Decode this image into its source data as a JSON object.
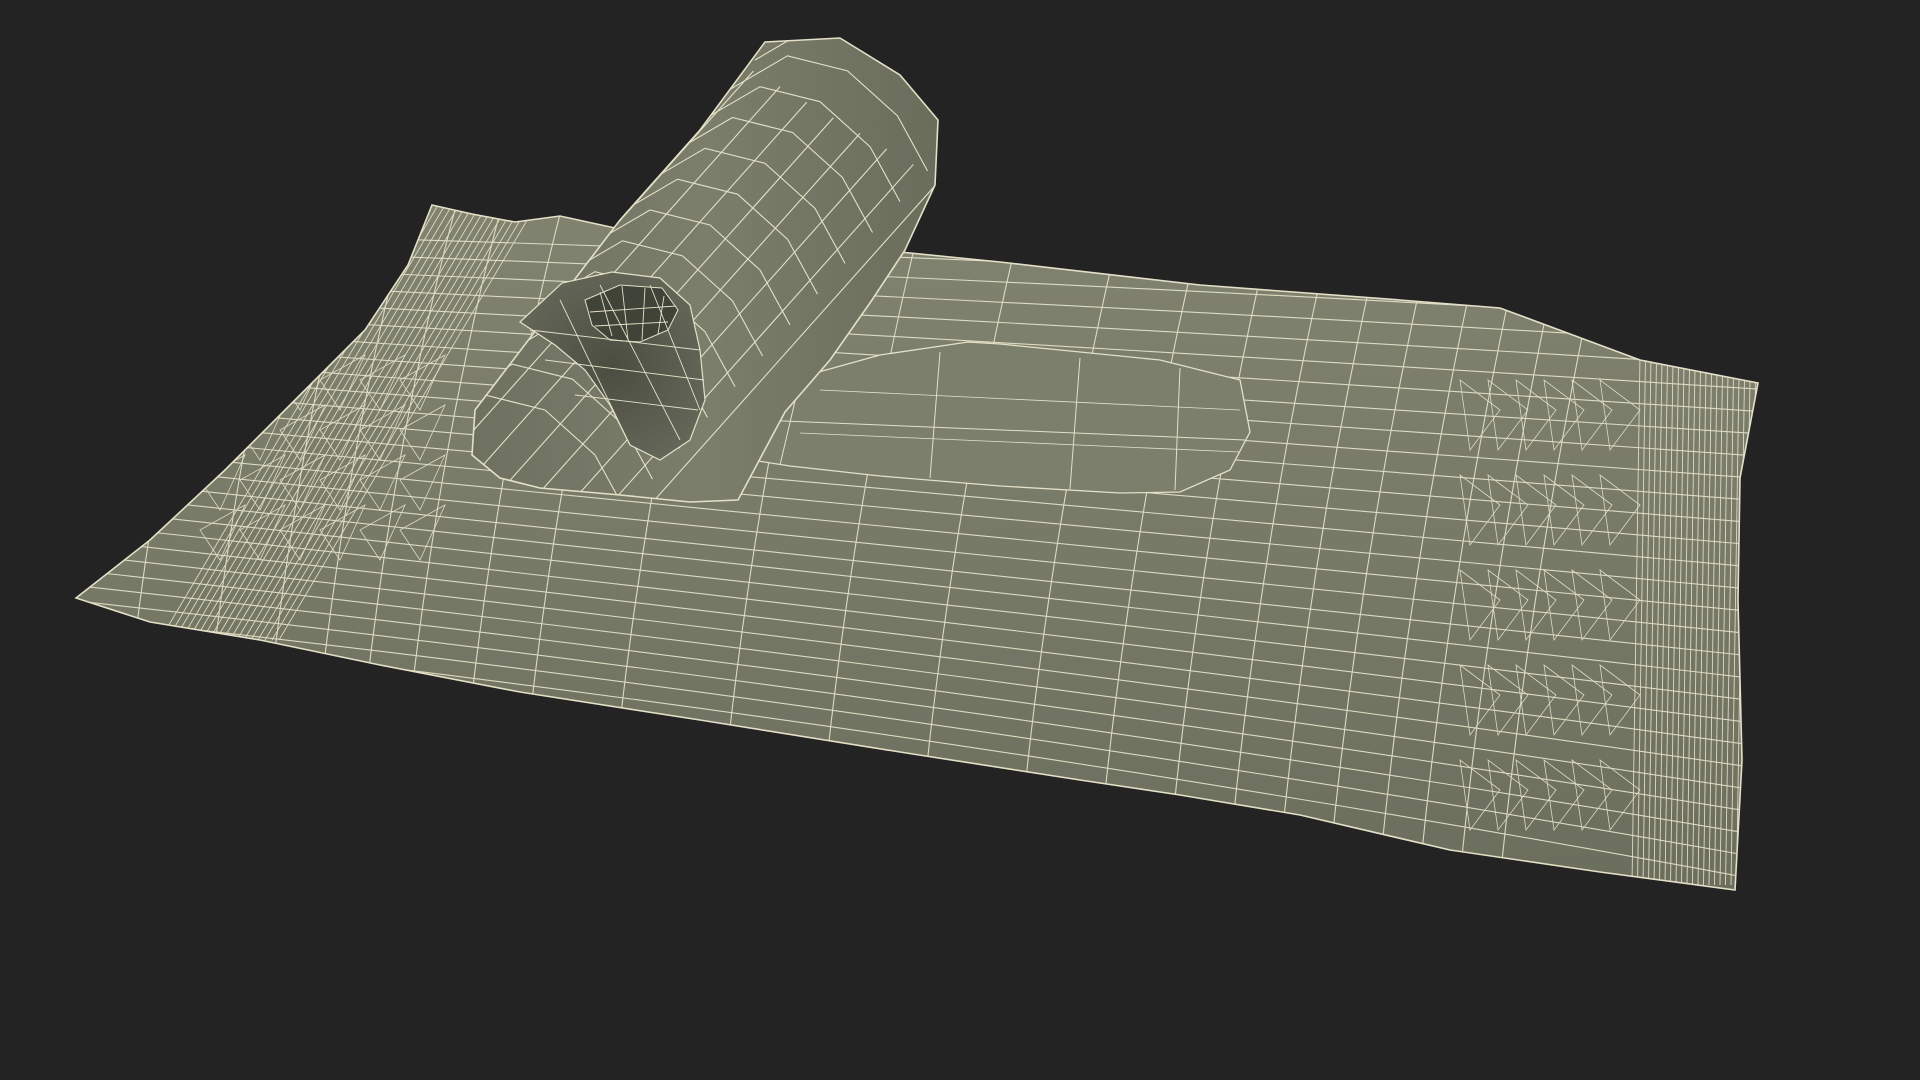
{
  "scene": {
    "subject": "wireframe-render",
    "colors": {
      "background": "#232323",
      "surface": "#787b69",
      "surface_dark": "#5c5f50",
      "surface_light": "#8d907e",
      "wire": "#e4e0c8"
    }
  }
}
